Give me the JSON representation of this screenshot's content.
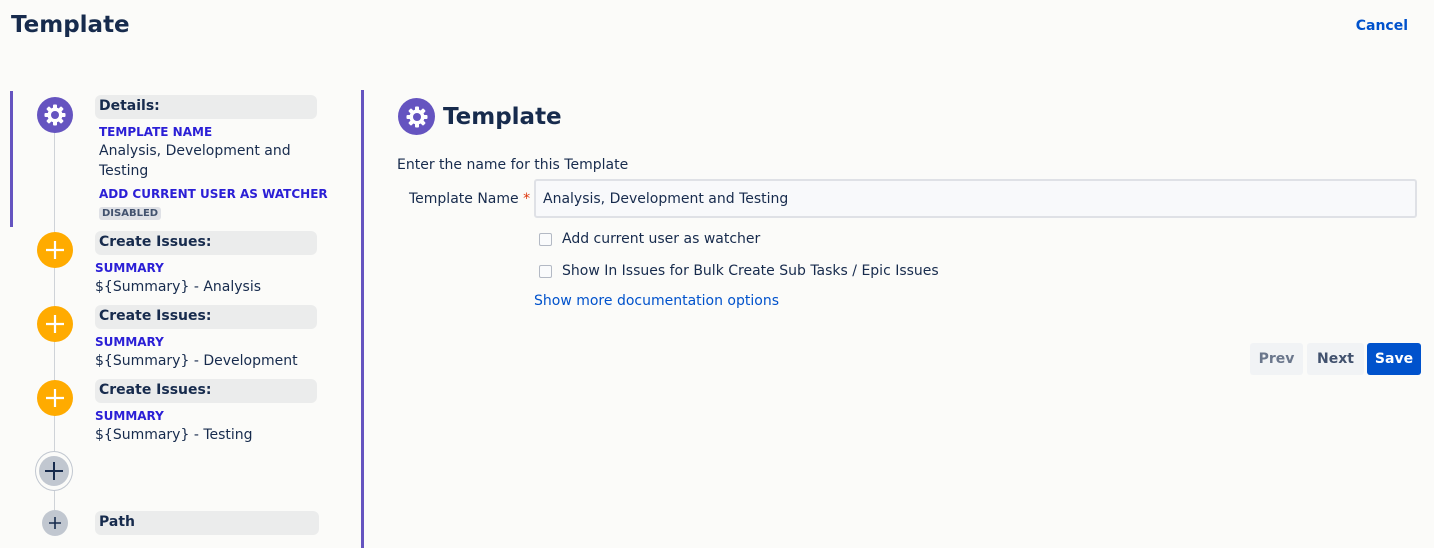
{
  "header": {
    "title": "Template",
    "cancel_label": "Cancel"
  },
  "timeline": {
    "details": {
      "header": "Details:",
      "template_name_label": "TEMPLATE NAME",
      "template_name_value": "Analysis, Development and Testing",
      "watcher_label": "ADD CURRENT USER AS WATCHER",
      "watcher_badge": "DISABLED"
    },
    "steps": [
      {
        "header": "Create Issues:",
        "field_label": "SUMMARY",
        "field_value": "${Summary} - Analysis"
      },
      {
        "header": "Create Issues:",
        "field_label": "SUMMARY",
        "field_value": "${Summary} - Development"
      },
      {
        "header": "Create Issues:",
        "field_label": "SUMMARY",
        "field_value": "${Summary} - Testing"
      }
    ],
    "path_header": "Path"
  },
  "form": {
    "title": "Template",
    "intro": "Enter the name for this Template",
    "name_label": "Template Name",
    "required_marker": "*",
    "name_value": "Analysis, Development and Testing",
    "checkbox_watcher": "Add current user as watcher",
    "checkbox_bulk": "Show In Issues for Bulk Create Sub Tasks / Epic Issues",
    "doc_link": "Show more documentation options",
    "prev_label": "Prev",
    "next_label": "Next",
    "save_label": "Save"
  },
  "colors": {
    "accent_purple": "#6554c0",
    "step_orange": "#ffab00",
    "primary_blue": "#0052cc",
    "label_blue": "#2b1fd6"
  },
  "icons": [
    "gear-icon",
    "plus-icon",
    "add-step-icon"
  ]
}
